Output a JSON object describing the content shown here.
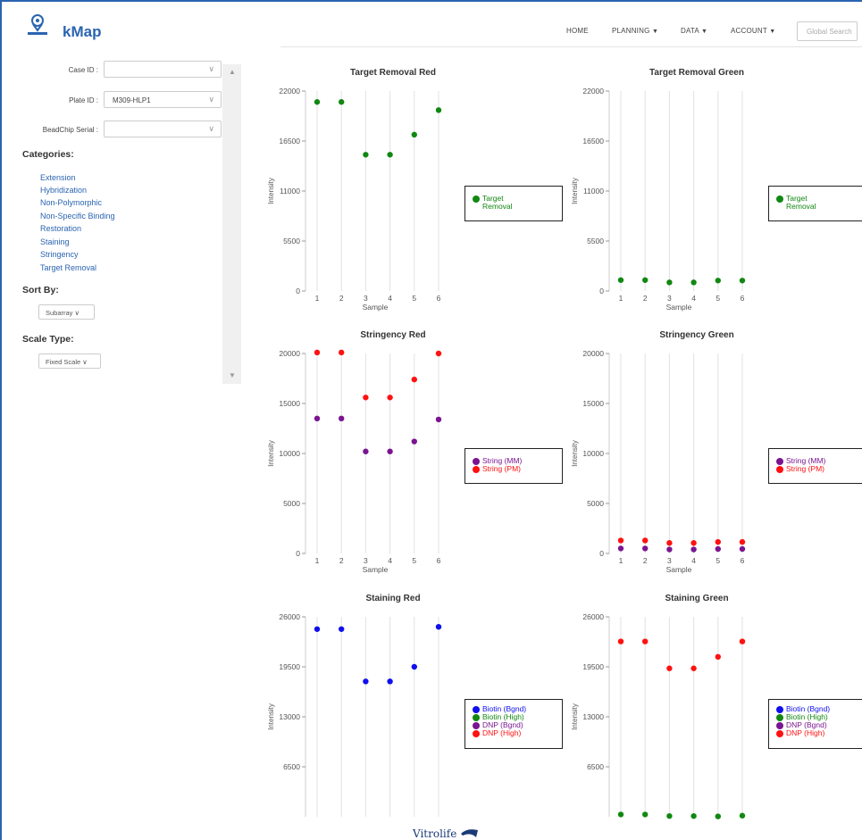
{
  "app": {
    "title": "kMap"
  },
  "nav": {
    "home": "HOME",
    "planning": "PLANNING",
    "data": "DATA",
    "account": "ACCOUNT",
    "search_placeholder": "Global Search"
  },
  "filters": {
    "case_label": "Case ID :",
    "case_value": "",
    "plate_label": "Plate ID :",
    "plate_value": "M309-HLP1",
    "beadchip_label": "BeadChip Serial :",
    "beadchip_value": ""
  },
  "categories": {
    "heading": "Categories:",
    "items": [
      "Extension",
      "Hybridization",
      "Non-Polymorphic",
      "Non-Specific Binding",
      "Restoration",
      "Staining",
      "Stringency",
      "Target Removal"
    ]
  },
  "sort": {
    "heading": "Sort By:",
    "value": "Subarray"
  },
  "scale": {
    "heading": "Scale Type:",
    "value": "Fixed Scale"
  },
  "footer": {
    "brand": "Vitrolife"
  },
  "colors": {
    "accent": "#2a64b0",
    "green": "#118811",
    "red": "#ff1111",
    "purple": "#7a1590",
    "blue": "#1010ee"
  },
  "chart_data": [
    {
      "type": "scatter",
      "title": "Target Removal Red",
      "xlabel": "Sample",
      "ylabel": "Intensity",
      "x": [
        1,
        2,
        3,
        4,
        5,
        6
      ],
      "ylim": [
        0,
        22000
      ],
      "yticks": [
        0,
        5500,
        11000,
        16500,
        22000
      ],
      "series": [
        {
          "name": "Target Removal",
          "color": "#118811",
          "values": [
            20800,
            20800,
            15000,
            15000,
            17200,
            19900
          ]
        }
      ]
    },
    {
      "type": "scatter",
      "title": "Target Removal Green",
      "xlabel": "Sample",
      "ylabel": "Intensity",
      "x": [
        1,
        2,
        3,
        4,
        5,
        6
      ],
      "ylim": [
        0,
        22000
      ],
      "yticks": [
        0,
        5500,
        11000,
        16500,
        22000
      ],
      "series": [
        {
          "name": "Target Removal",
          "color": "#118811",
          "values": [
            1200,
            1200,
            950,
            950,
            1150,
            1150
          ]
        }
      ]
    },
    {
      "type": "scatter",
      "title": "Stringency Red",
      "xlabel": "Sample",
      "ylabel": "Intensity",
      "x": [
        1,
        2,
        3,
        4,
        5,
        6
      ],
      "ylim": [
        0,
        20000
      ],
      "yticks": [
        0,
        5000,
        10000,
        15000,
        20000
      ],
      "series": [
        {
          "name": "String (MM)",
          "color": "#7a1590",
          "values": [
            13500,
            13500,
            10200,
            10200,
            11200,
            13400
          ]
        },
        {
          "name": "String (PM)",
          "color": "#ff1111",
          "values": [
            20100,
            20100,
            15600,
            15600,
            17400,
            20000
          ]
        }
      ]
    },
    {
      "type": "scatter",
      "title": "Stringency Green",
      "xlabel": "Sample",
      "ylabel": "Intensity",
      "x": [
        1,
        2,
        3,
        4,
        5,
        6
      ],
      "ylim": [
        0,
        20000
      ],
      "yticks": [
        0,
        5000,
        10000,
        15000,
        20000
      ],
      "series": [
        {
          "name": "String (MM)",
          "color": "#7a1590",
          "values": [
            500,
            500,
            400,
            400,
            450,
            450
          ]
        },
        {
          "name": "String (PM)",
          "color": "#ff1111",
          "values": [
            1300,
            1300,
            1050,
            1050,
            1150,
            1150
          ]
        }
      ]
    },
    {
      "type": "scatter",
      "title": "Staining Red",
      "xlabel": "",
      "ylabel": "Intensity",
      "x": [
        1,
        2,
        3,
        4,
        5,
        6
      ],
      "ylim": [
        0,
        26000
      ],
      "yticks": [
        6500,
        13000,
        19500,
        26000
      ],
      "series": [
        {
          "name": "Biotin (Bgnd)",
          "color": "#1010ee",
          "values": [
            24400,
            24400,
            17600,
            17600,
            19500,
            24700
          ]
        },
        {
          "name": "Biotin (High)",
          "color": "#118811",
          "values": []
        },
        {
          "name": "DNP (Bgnd)",
          "color": "#7a1590",
          "values": []
        },
        {
          "name": "DNP (High)",
          "color": "#ff1111",
          "values": []
        }
      ]
    },
    {
      "type": "scatter",
      "title": "Staining Green",
      "xlabel": "",
      "ylabel": "Intensity",
      "x": [
        1,
        2,
        3,
        4,
        5,
        6
      ],
      "ylim": [
        0,
        26000
      ],
      "yticks": [
        6500,
        13000,
        19500,
        26000
      ],
      "series": [
        {
          "name": "Biotin (Bgnd)",
          "color": "#1010ee",
          "values": []
        },
        {
          "name": "Biotin (High)",
          "color": "#118811",
          "values": [
            300,
            300,
            100,
            100,
            50,
            150
          ]
        },
        {
          "name": "DNP (Bgnd)",
          "color": "#7a1590",
          "values": []
        },
        {
          "name": "DNP (High)",
          "color": "#ff1111",
          "values": [
            22800,
            22800,
            19300,
            19300,
            20800,
            22800
          ]
        }
      ]
    }
  ]
}
